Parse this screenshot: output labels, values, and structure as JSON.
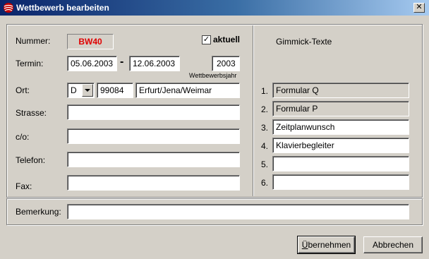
{
  "window": {
    "title": "Wettbewerb bearbeiten",
    "close_glyph": "✕"
  },
  "left": {
    "nummer_label": "Nummer:",
    "nummer_value": "BW40",
    "aktuell_label": "aktuell",
    "aktuell_checked": true,
    "termin_label": "Termin:",
    "date_from": "05.06.2003",
    "date_sep": "-",
    "date_to": "12.06.2003",
    "jahr_value": "2003",
    "jahr_caption": "Wettbewerbsjahr",
    "ort_label": "Ort:",
    "country": "D",
    "plz": "99084",
    "city": "Erfurt/Jena/Weimar",
    "strasse_label": "Strasse:",
    "strasse_value": "",
    "co_label": "c/o:",
    "co_value": "",
    "telefon_label": "Telefon:",
    "telefon_value": "",
    "fax_label": "Fax:",
    "fax_value": ""
  },
  "gimmick": {
    "title": "Gimmick-Texte",
    "items": [
      {
        "num": "1.",
        "text": "Formular Q"
      },
      {
        "num": "2.",
        "text": "Formular P"
      },
      {
        "num": "3.",
        "text": "Zeitplanwunsch"
      },
      {
        "num": "4.",
        "text": "Klavierbegleiter"
      },
      {
        "num": "5.",
        "text": ""
      },
      {
        "num": "6.",
        "text": ""
      }
    ]
  },
  "bemerkung": {
    "label": "Bemerkung:",
    "value": ""
  },
  "buttons": {
    "ok_prefix": "Ü",
    "ok_rest": "bernehmen",
    "cancel": "Abbrechen"
  },
  "colors": {
    "title_start": "#0a246a",
    "title_end": "#a6caf0",
    "nummer_text": "#e00000",
    "face": "#d4d0c8"
  }
}
